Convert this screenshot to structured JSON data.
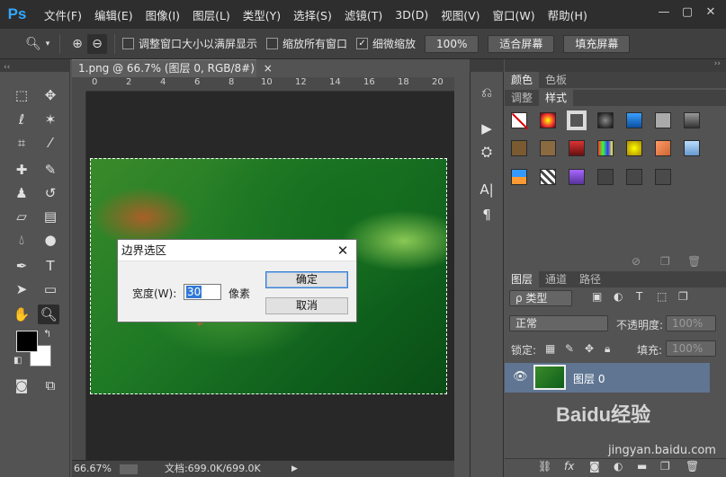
{
  "app": {
    "logo": "Ps"
  },
  "menu": [
    "文件(F)",
    "编辑(E)",
    "图像(I)",
    "图层(L)",
    "类型(Y)",
    "选择(S)",
    "滤镜(T)",
    "3D(D)",
    "视图(V)",
    "窗口(W)",
    "帮助(H)"
  ],
  "window_controls": {
    "minimize": "—",
    "maximize": "▢",
    "close": "✕"
  },
  "options": {
    "resize_windows": "调整窗口大小以满屏显示",
    "zoom_all": "缩放所有窗口",
    "scrubby_zoom": "细微缩放",
    "zoom_100": "100%",
    "fit_screen": "适合屏幕",
    "fill_screen": "填充屏幕",
    "checked": {
      "resize_windows": false,
      "zoom_all": false,
      "scrubby_zoom": true
    }
  },
  "document": {
    "tab_title": "1.png @ 66.7% (图层 0, RGB/8#)",
    "tab_close": "×",
    "ruler_ticks": [
      "0",
      "2",
      "4",
      "6",
      "8",
      "10",
      "12",
      "14",
      "16",
      "18",
      "20"
    ]
  },
  "dialog": {
    "title": "边界选区",
    "close": "✕",
    "width_label": "宽度(W):",
    "width_value": "30",
    "unit": "像素",
    "ok": "确定",
    "cancel": "取消"
  },
  "status": {
    "zoom": "66.67%",
    "doc_info": "文档:699.0K/699.0K",
    "arrow": "▶"
  },
  "panels": {
    "color_tabs": [
      "颜色",
      "色板"
    ],
    "style_tabs": [
      "调整",
      "样式"
    ],
    "layer_tabs": [
      "图层",
      "通道",
      "路径"
    ],
    "kind_filter": "ρ 类型",
    "blend_mode": "正常",
    "opacity_label": "不透明度:",
    "opacity_value": "100%",
    "lock_label": "锁定:",
    "fill_label": "填充:",
    "fill_value": "100%",
    "layer_name": "图层 0"
  },
  "watermark": {
    "brand": "Baidu经验",
    "url": "jingyan.baidu.com"
  },
  "colors": {
    "accent": "#31a8ff",
    "selected_layer": "#5f7592",
    "foreground": "#000000",
    "background": "#ffffff"
  }
}
